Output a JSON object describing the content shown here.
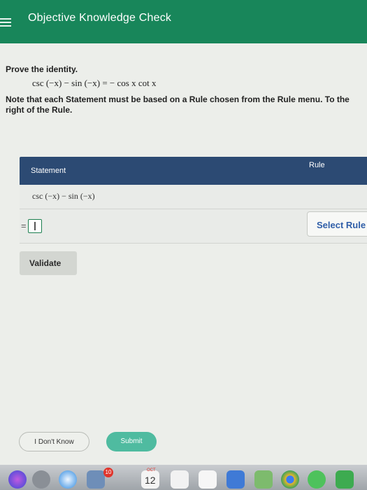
{
  "header": {
    "title": "Objective Knowledge Check"
  },
  "question": {
    "prompt": "Prove the identity.",
    "identity": "csc (−x) − sin (−x) = − cos x cot x",
    "note": "Note that each Statement must be based on a Rule chosen from the Rule menu. To the right of the Rule."
  },
  "table": {
    "statement_header": "Statement",
    "rule_header": "Rule",
    "rows": [
      {
        "statement": "csc (−x) − sin (−x)"
      },
      {
        "prefix": "=",
        "rule_button": "Select Rule"
      }
    ]
  },
  "buttons": {
    "validate": "Validate",
    "dont_know": "I Don't Know",
    "submit": "Submit"
  },
  "dock": {
    "badge_count": "10",
    "calendar_month": "OCT",
    "calendar_day": "12"
  },
  "colors": {
    "header_bg": "#18865a",
    "table_header_bg": "#2c4a73",
    "submit_bg": "#4fbba0",
    "link_blue": "#2f5ea8"
  }
}
